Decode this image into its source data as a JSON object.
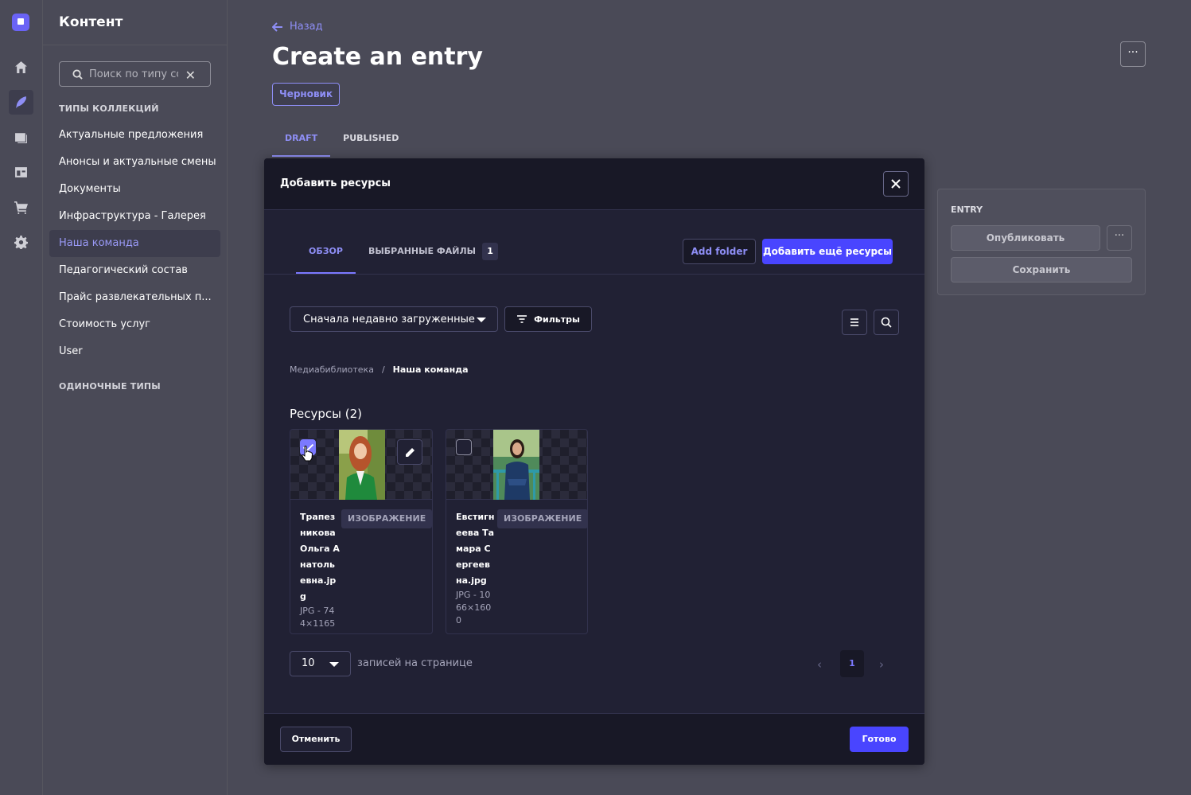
{
  "nav_rail": {
    "items": [
      "home-icon",
      "content-manager-icon",
      "media-library-icon",
      "content-type-builder-icon",
      "marketplace-icon",
      "settings-icon"
    ]
  },
  "sidebar": {
    "title": "Контент",
    "search_placeholder": "Поиск по типу сод",
    "collection_types_label": "ТИПЫ КОЛЛЕКЦИЙ",
    "items": [
      {
        "label": "Актуальные предложения",
        "active": false
      },
      {
        "label": "Анонсы и актуальные смены",
        "active": false
      },
      {
        "label": "Документы",
        "active": false
      },
      {
        "label": "Инфраструктура - Галерея",
        "active": false
      },
      {
        "label": "Наша команда",
        "active": true
      },
      {
        "label": "Педагогический состав",
        "active": false
      },
      {
        "label": "Прайс развлекательных п...",
        "active": false
      },
      {
        "label": "Стоимость услуг",
        "active": false
      },
      {
        "label": "User",
        "active": false
      }
    ],
    "single_types_label": "ОДИНОЧНЫЕ ТИПЫ"
  },
  "page": {
    "back_label": "Назад",
    "title": "Create an entry",
    "status_badge": "Черновик",
    "more_label": "···",
    "tabs": [
      {
        "label": "DRAFT",
        "active": true
      },
      {
        "label": "PUBLISHED",
        "active": false
      }
    ],
    "entry_panel": {
      "label": "ENTRY",
      "publish_label": "Опубликовать",
      "more_label": "···",
      "save_label": "Сохранить"
    }
  },
  "modal": {
    "title": "Добавить ресурсы",
    "tabs": [
      {
        "label": "ОБЗОР",
        "active": true
      },
      {
        "label": "ВЫБРАННЫЕ ФАЙЛЫ",
        "count": "1",
        "active": false
      }
    ],
    "add_folder_label": "Add folder",
    "add_more_label": "Добавить ещё ресурсы",
    "sort_value": "Сначала недавно загруженные",
    "filters_label": "Фильтры",
    "breadcrumb": {
      "root": "Медиабиблиотека",
      "separator": "/",
      "current": "Наша команда"
    },
    "assets_title": "Ресурсы (2)",
    "assets": [
      {
        "name": "Трапезникова Ольга Анатольевна.jpg",
        "type": "ИЗОБРАЖЕНИЕ",
        "meta": "JPG - 744×1165",
        "checked": true
      },
      {
        "name": "Евстигнеева Тамара Сергеевна.jpg",
        "type": "ИЗОБРАЖЕНИЕ",
        "meta": "JPG - 1066×1600",
        "checked": false
      }
    ],
    "per_page_value": "10",
    "per_page_label": "записей на странице",
    "current_page": "1",
    "cancel_label": "Отменить",
    "done_label": "Готово"
  },
  "colors": {
    "accent": "#4945ff",
    "accent_light": "#8e8ef5",
    "modal_bg": "#212134",
    "modal_header_bg": "#181826",
    "backdrop": "#4a4a57"
  }
}
